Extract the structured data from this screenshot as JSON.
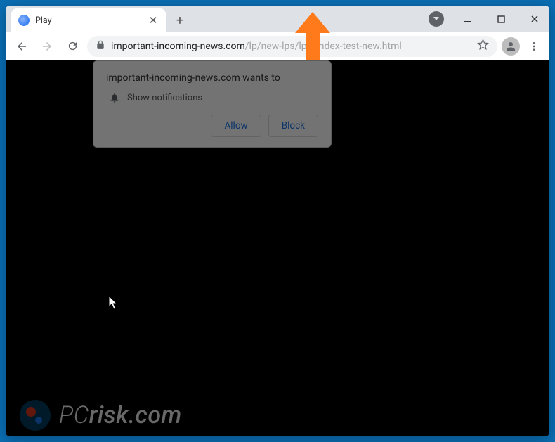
{
  "tab": {
    "title": "Play"
  },
  "url": {
    "host": "important-incoming-news.com",
    "path": "/lp/new-lps/lp2/index-test-new.html"
  },
  "prompt": {
    "title": "important-incoming-news.com wants to",
    "permission": "Show notifications",
    "allow": "Allow",
    "block": "Block"
  },
  "watermark": {
    "text_pc": "PC",
    "text_rest": "risk.com"
  }
}
